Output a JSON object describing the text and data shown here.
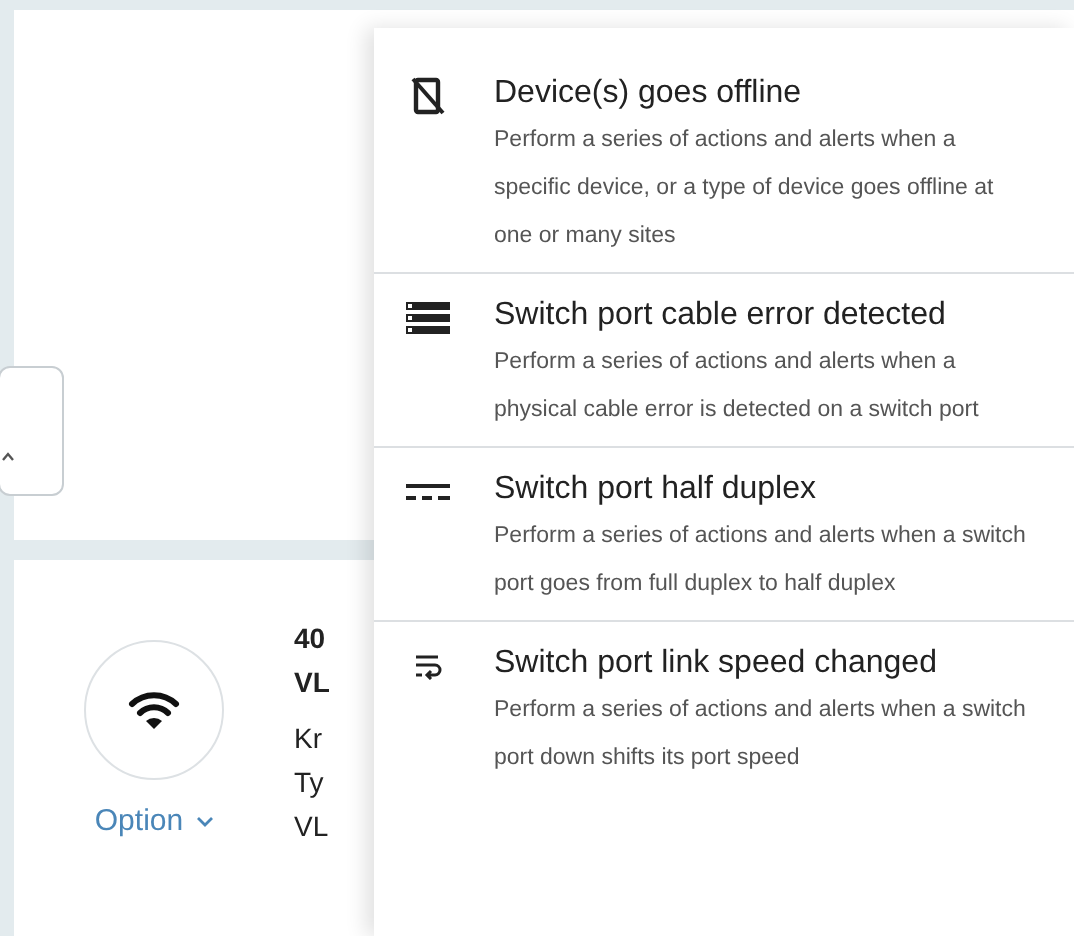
{
  "left_panel": {
    "side_values": [
      "40",
      "VL",
      "Kr",
      "Ty",
      "VL"
    ],
    "option_button": {
      "label": "Option"
    }
  },
  "menu": {
    "items": [
      {
        "kind": "device-offline",
        "title": "Device(s) goes offline",
        "description": "Perform a series of actions and alerts when a specific device, or a type of device goes offline at one or many sites"
      },
      {
        "kind": "cable-error",
        "title": "Switch port cable error detected",
        "description": "Perform a series of actions and alerts when a physical cable error is detected on a switch port"
      },
      {
        "kind": "half-duplex",
        "title": "Switch port half duplex",
        "description": "Perform a series of actions and alerts when a switch port goes from full duplex to half duplex"
      },
      {
        "kind": "link-speed",
        "title": "Switch port link speed changed",
        "description": "Perform a series of actions and alerts when a switch port down shifts its port speed"
      }
    ]
  }
}
